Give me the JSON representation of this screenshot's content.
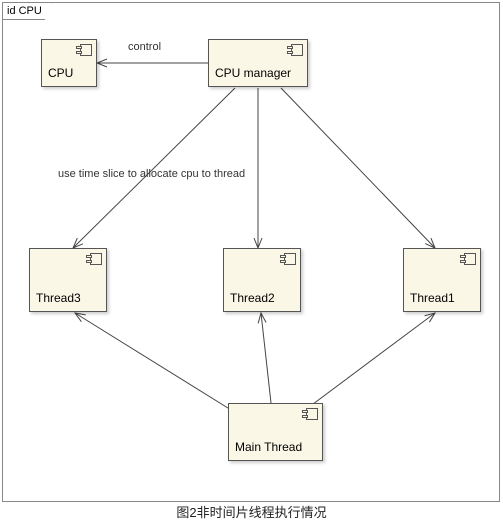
{
  "frame": {
    "title": "id CPU"
  },
  "components": {
    "cpu": {
      "label": "CPU"
    },
    "cpu_manager": {
      "label": "CPU manager"
    },
    "thread3": {
      "label": "Thread3"
    },
    "thread2": {
      "label": "Thread2"
    },
    "thread1": {
      "label": "Thread1"
    },
    "main_thread": {
      "label": "Main Thread"
    }
  },
  "edges": {
    "control": {
      "label": "control"
    },
    "allocate": {
      "label": "use time slice to allocate cpu to thread"
    }
  },
  "caption": "图2非时间片线程执行情况",
  "diagram": {
    "type": "uml-component-diagram",
    "nodes": [
      "CPU",
      "CPU manager",
      "Thread1",
      "Thread2",
      "Thread3",
      "Main Thread"
    ],
    "relations": [
      {
        "from": "CPU manager",
        "to": "CPU",
        "label": "control",
        "kind": "control"
      },
      {
        "from": "CPU manager",
        "to": "Thread1",
        "label": "use time slice to allocate cpu to thread",
        "kind": "allocate"
      },
      {
        "from": "CPU manager",
        "to": "Thread2",
        "label": "use time slice to allocate cpu to thread",
        "kind": "allocate"
      },
      {
        "from": "CPU manager",
        "to": "Thread3",
        "label": "use time slice to allocate cpu to thread",
        "kind": "allocate"
      },
      {
        "from": "Main Thread",
        "to": "Thread1",
        "kind": "assoc"
      },
      {
        "from": "Main Thread",
        "to": "Thread2",
        "kind": "assoc"
      },
      {
        "from": "Main Thread",
        "to": "Thread3",
        "kind": "assoc"
      }
    ]
  }
}
